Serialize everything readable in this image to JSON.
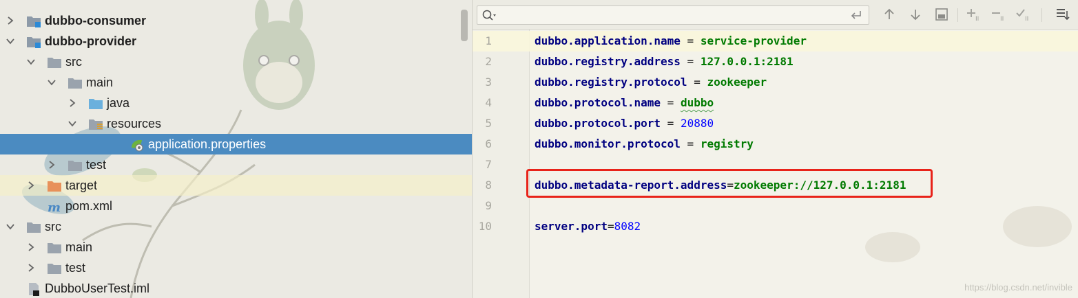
{
  "tree": {
    "rows": [
      {
        "label": "dubbo-consumer",
        "icon": "module-folder-icon",
        "expand": "collapsed",
        "bold": true
      },
      {
        "label": "dubbo-provider",
        "icon": "module-folder-icon",
        "expand": "expanded",
        "bold": true
      },
      {
        "label": "src",
        "icon": "folder-icon",
        "expand": "expanded"
      },
      {
        "label": "main",
        "icon": "folder-icon",
        "expand": "expanded"
      },
      {
        "label": "java",
        "icon": "source-folder-icon",
        "expand": "collapsed"
      },
      {
        "label": "resources",
        "icon": "resources-folder-icon",
        "expand": "expanded"
      },
      {
        "label": "application.properties",
        "icon": "spring-properties-icon",
        "expand": "none",
        "selected": true
      },
      {
        "label": "test",
        "icon": "folder-icon",
        "expand": "collapsed"
      },
      {
        "label": "target",
        "icon": "excluded-folder-icon",
        "expand": "collapsed",
        "caret_line": true
      },
      {
        "label": "pom.xml",
        "icon": "maven-icon",
        "expand": "none"
      },
      {
        "label": "src",
        "icon": "folder-icon",
        "expand": "expanded"
      },
      {
        "label": "main",
        "icon": "folder-icon",
        "expand": "collapsed"
      },
      {
        "label": "test",
        "icon": "folder-icon",
        "expand": "collapsed"
      },
      {
        "label": "DubboUserTest.iml",
        "icon": "iml-file-icon",
        "expand": "none"
      }
    ]
  },
  "editor": {
    "search": {
      "icon": "search-icon",
      "value": ""
    },
    "toolbar_icons": [
      "enter-icon",
      "arrow-up-icon",
      "arrow-down-icon",
      "find-in-selection-icon",
      "add-occurrence-icon",
      "remove-occurrence-icon",
      "select-all-occurrences-icon",
      "filter-icon"
    ],
    "lines": [
      {
        "n": "1",
        "key": "dubbo.application.name",
        "sep": " = ",
        "value": "service-provider",
        "kind": "str"
      },
      {
        "n": "2",
        "key": "dubbo.registry.address",
        "sep": " = ",
        "value": "127.0.0.1:2181",
        "kind": "str"
      },
      {
        "n": "3",
        "key": "dubbo.registry.protocol",
        "sep": " = ",
        "value": "zookeeper",
        "kind": "str"
      },
      {
        "n": "4",
        "key": "dubbo.protocol.name",
        "sep": " = ",
        "value": "dubbo",
        "kind": "str",
        "squiggle": true
      },
      {
        "n": "5",
        "key": "dubbo.protocol.port",
        "sep": " = ",
        "value": "20880",
        "kind": "num"
      },
      {
        "n": "6",
        "key": "dubbo.monitor.protocol",
        "sep": " = ",
        "value": "registry",
        "kind": "str"
      },
      {
        "n": "7",
        "key": "",
        "sep": "",
        "value": "",
        "kind": "empty"
      },
      {
        "n": "8",
        "key": "dubbo.metadata-report.address",
        "sep": "=",
        "value": "zookeeper://127.0.0.1:2181",
        "kind": "str",
        "highlighted": true
      },
      {
        "n": "9",
        "key": "",
        "sep": "",
        "value": "",
        "kind": "empty"
      },
      {
        "n": "10",
        "key": "server.port",
        "sep": "=",
        "value": "8082",
        "kind": "num"
      }
    ],
    "watermark": "https://blog.csdn.net/invible"
  },
  "colors": {
    "selection": "#4b8bc1",
    "highlight_box": "#e8231a",
    "key": "#000080",
    "value": "#007a00",
    "number": "#0000ff"
  }
}
